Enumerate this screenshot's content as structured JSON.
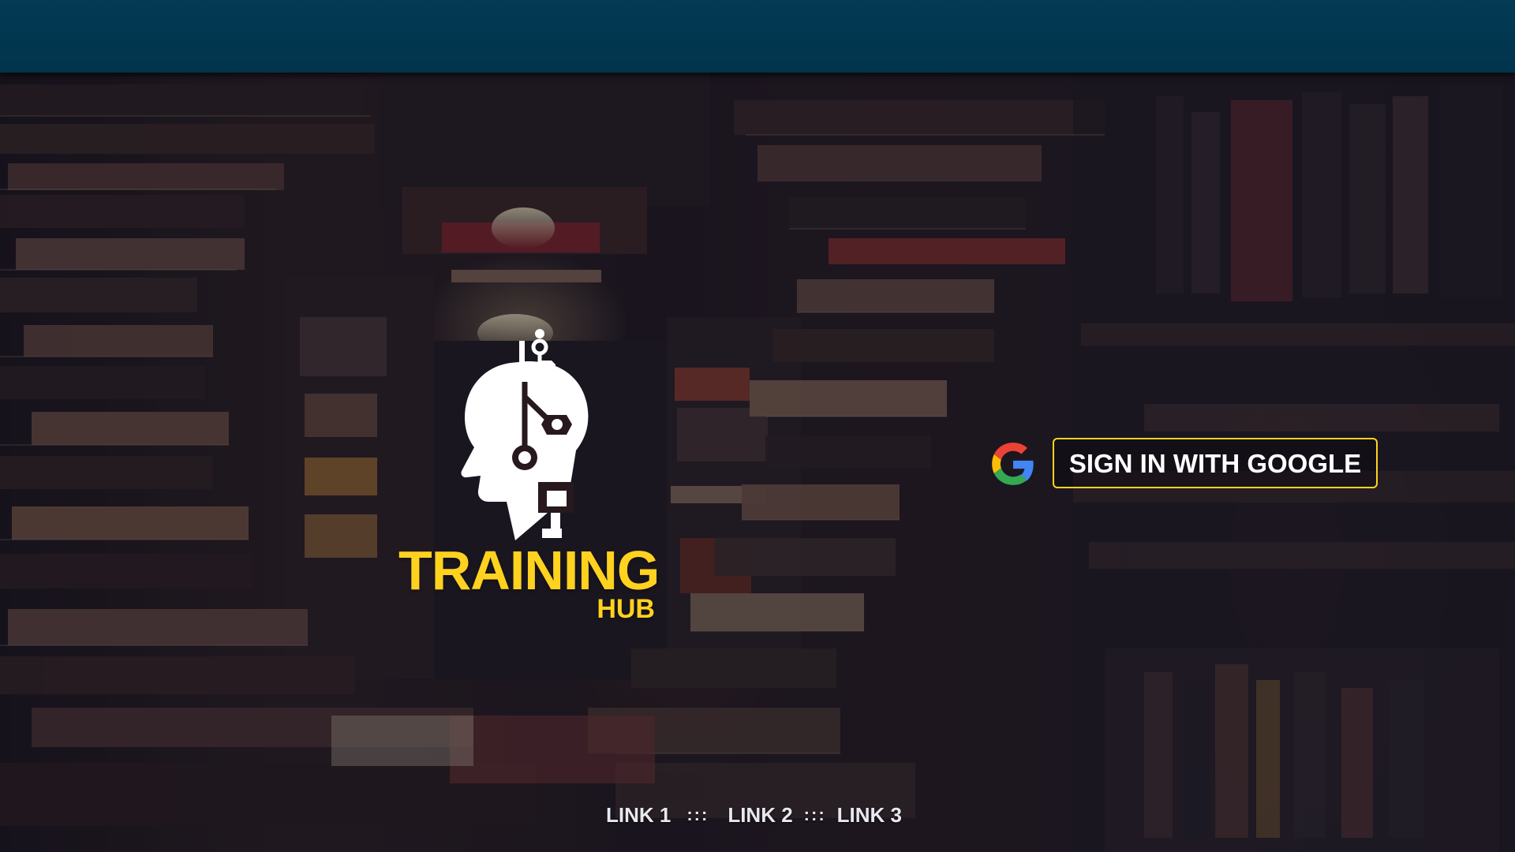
{
  "brand": {
    "title": "TRAINING",
    "subtitle": "HUB",
    "logo_icon": "ai-head-icon",
    "accent": "#ffd21f"
  },
  "auth": {
    "button_label": "SIGN IN WITH GOOGLE",
    "provider_icon": "google-icon"
  },
  "footer": {
    "links": [
      "LINK 1",
      "LINK 2",
      "LINK 3"
    ],
    "separator": ":::"
  },
  "colors": {
    "header": "#023a53",
    "button_border": "#ffd21f",
    "text": "#ffffff",
    "google_blue": "#4285f4",
    "google_red": "#ea4335",
    "google_yellow": "#fbbc05",
    "google_green": "#34a853"
  }
}
